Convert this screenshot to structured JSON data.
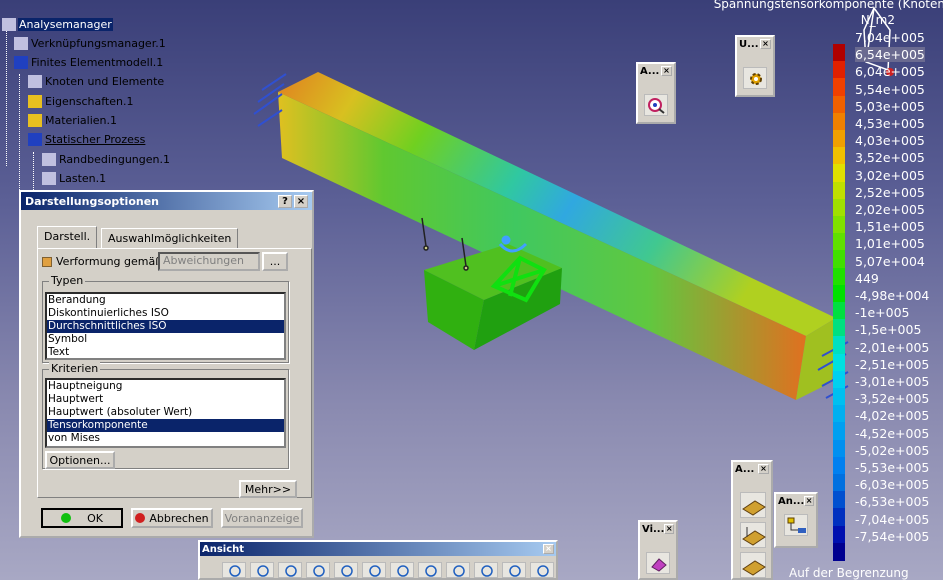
{
  "tree": {
    "items": [
      {
        "label": "Analysemanager",
        "icon": "analysis-manager-icon",
        "sel": true
      },
      {
        "label": "Verknüpfungsmanager.1",
        "icon": "link-manager-icon"
      },
      {
        "label": "Finites Elementmodell.1",
        "icon": "fem-model-icon"
      },
      {
        "label": "Knoten und Elemente",
        "icon": "nodes-elements-icon"
      },
      {
        "label": "Eigenschaften.1",
        "icon": "folder-icon"
      },
      {
        "label": "Materialien.1",
        "icon": "folder-icon"
      },
      {
        "label": "Statischer Prozess",
        "icon": "static-case-icon",
        "ul": true
      },
      {
        "label": "Randbedingungen.1",
        "icon": "restraints-icon"
      },
      {
        "label": "Lasten.1",
        "icon": "loads-icon"
      }
    ]
  },
  "dialog": {
    "title": "Darstellungsoptionen",
    "help": "?",
    "close": "×",
    "tab_active": "Darstell.",
    "tab_other": "Auswahlmöglichkeiten",
    "deform_label": "Verformung gemäß",
    "deform_value": "Abweichungen",
    "browse": "...",
    "types_label": "Typen",
    "types": [
      "Berandung",
      "Diskontinuierliches ISO",
      "Durchschnittliches ISO",
      "Symbol",
      "Text"
    ],
    "types_selected": 2,
    "criteria_label": "Kriterien",
    "criteria": [
      "Hauptneigung",
      "Hauptwert",
      "Hauptwert (absoluter Wert)",
      "Tensorkomponente",
      "von Mises"
    ],
    "criteria_selected": 3,
    "options_btn": "Optionen...",
    "more_btn": "Mehr>>",
    "ok": "OK",
    "cancel": "Abbrechen",
    "preview": "Vorananzeige"
  },
  "toolbars": {
    "a1": {
      "title": "A..."
    },
    "u": {
      "title": "U..."
    },
    "a2": {
      "title": "A..."
    },
    "an": {
      "title": "An..."
    },
    "vi": {
      "title": "Vi..."
    },
    "ansicht": {
      "title": "Ansicht"
    },
    "close": "×"
  },
  "legend": {
    "title": "Spannungstensorkomponente (Knoten",
    "unit": "N_m2",
    "values": [
      "7,04e+005",
      "6,54e+005",
      "6,04e+005",
      "5,54e+005",
      "5,03e+005",
      "4,53e+005",
      "4,03e+005",
      "3,52e+005",
      "3,02e+005",
      "2,52e+005",
      "2,02e+005",
      "1,51e+005",
      "1,01e+005",
      "5,07e+004",
      "449",
      "-4,98e+004",
      "-1e+005",
      "-1,5e+005",
      "-2,01e+005",
      "-2,51e+005",
      "-3,01e+005",
      "-3,52e+005",
      "-4,02e+005",
      "-4,52e+005",
      "-5,02e+005",
      "-5,53e+005",
      "-6,03e+005",
      "-6,53e+005",
      "-7,04e+005",
      "-7,54e+005"
    ],
    "colors": [
      "#b00000",
      "#e02000",
      "#f04000",
      "#f06000",
      "#f08000",
      "#f0a000",
      "#f0c000",
      "#e0e000",
      "#c0e000",
      "#a0e000",
      "#80e000",
      "#60e000",
      "#40e000",
      "#20e000",
      "#00e000",
      "#00e040",
      "#00e080",
      "#00e0c0",
      "#00e0e0",
      "#00d0f0",
      "#00c0f0",
      "#00b0f0",
      "#00a0f0",
      "#0090f0",
      "#0080f0",
      "#0070e0",
      "#0050d0",
      "#0030c0",
      "#0010b0",
      "#000090"
    ],
    "footer": "Auf der Begrenzung"
  }
}
